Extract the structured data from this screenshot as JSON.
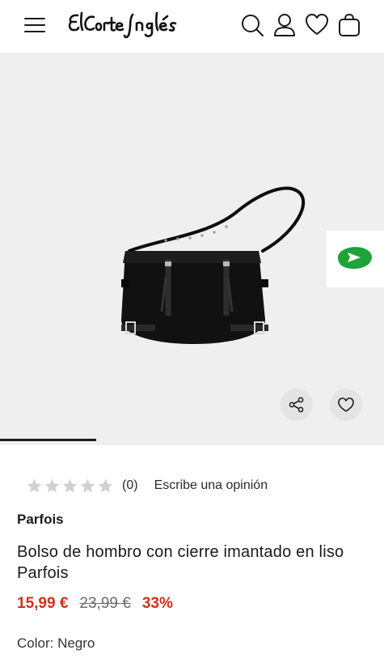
{
  "header": {
    "brand_name": "El Corte Inglés",
    "icons": [
      "menu-icon",
      "search-icon",
      "user-icon",
      "heart-icon",
      "bag-icon"
    ]
  },
  "gallery": {
    "image_subject": "black shoulder bag",
    "progress": 0.25,
    "actions": [
      "share-icon",
      "heart-icon"
    ],
    "background_color": "#efefef"
  },
  "rating": {
    "stars": 0,
    "max_stars": 5,
    "count": "(0)",
    "review_link": "Escribe una opinión"
  },
  "product": {
    "brand": "Parfois",
    "title": "Bolso de hombro con cierre imantado en liso Parfois",
    "price_now": "15,99 €",
    "price_old": "23,99 €",
    "discount": "33%",
    "color_text": "Color: Negro"
  },
  "colors": {
    "accent_red": "#d0311c",
    "badge_green": "#1ea23a"
  }
}
